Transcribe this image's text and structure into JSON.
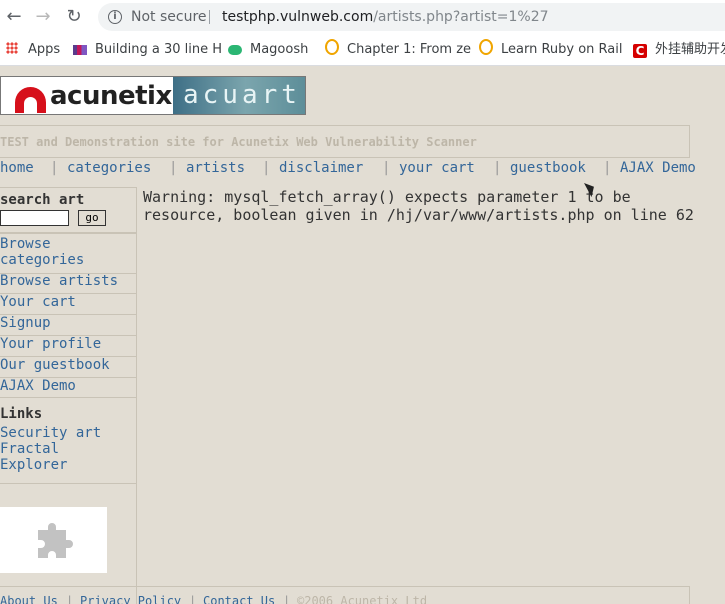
{
  "browser": {
    "security_label": "Not secure",
    "url_host": "testphp.vulnweb.com",
    "url_path": "/artists.php?artist=1%27"
  },
  "bookmarks": [
    {
      "label": "Apps",
      "icon": "apps-grid-icon"
    },
    {
      "label": "Building a 30 line H",
      "icon": "bar-chart-icon"
    },
    {
      "label": "Magoosh",
      "icon": "magoosh-icon"
    },
    {
      "label": "Chapter 1: From ze",
      "icon": "circle-o-icon"
    },
    {
      "label": "Learn Ruby on Rail",
      "icon": "circle-o-icon"
    },
    {
      "label": "外挂辅助开发",
      "icon": "c-icon"
    }
  ],
  "site": {
    "logo_text": "acunetix",
    "logo_art_text": "acuart",
    "tagline": "TEST and Demonstration site for Acunetix Web Vulnerability Scanner"
  },
  "menu": [
    "home",
    "categories",
    "artists",
    "disclaimer",
    "your cart",
    "guestbook",
    "AJAX Demo"
  ],
  "sidebar": {
    "search_title": "search art",
    "go_label": "go",
    "links": [
      "Browse categories",
      "Browse artists",
      "Your cart",
      "Signup",
      "Your profile",
      "Our guestbook",
      "AJAX Demo"
    ],
    "links_title": "Links",
    "external_links": [
      "Security art",
      "Fractal Explorer"
    ]
  },
  "content": {
    "warning": "Warning: mysql_fetch_array() expects parameter 1 to be resource, boolean given in /hj/var/www/artists.php on line 62"
  },
  "footer": {
    "links": [
      "About Us",
      "Privacy Policy",
      "Contact Us"
    ],
    "copyright": "©2006 Acunetix Ltd"
  }
}
